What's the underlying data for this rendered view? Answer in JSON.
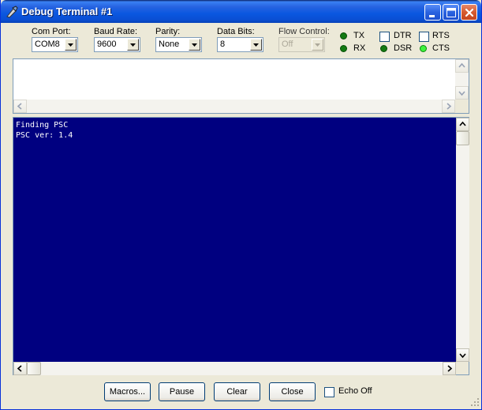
{
  "window": {
    "title": "Debug Terminal #1"
  },
  "settings": {
    "com_port": {
      "label": "Com Port:",
      "value": "COM8"
    },
    "baud_rate": {
      "label": "Baud Rate:",
      "value": "9600"
    },
    "parity": {
      "label": "Parity:",
      "value": "None"
    },
    "data_bits": {
      "label": "Data Bits:",
      "value": "8"
    },
    "flow_control": {
      "label": "Flow Control:",
      "value": "Off"
    }
  },
  "signals": {
    "tx": {
      "label": "TX",
      "state": "off"
    },
    "rx": {
      "label": "RX",
      "state": "off"
    },
    "dsr": {
      "label": "DSR",
      "state": "off"
    },
    "cts": {
      "label": "CTS",
      "state": "on"
    },
    "dtr": {
      "label": "DTR",
      "checked": false
    },
    "rts": {
      "label": "RTS",
      "checked": false
    }
  },
  "output": {
    "lines": [
      "Finding PSC",
      "PSC ver: 1.4"
    ]
  },
  "buttons": {
    "macros": "Macros...",
    "pause": "Pause",
    "clear": "Clear",
    "close": "Close"
  },
  "echo_off": {
    "label": "Echo Off",
    "checked": false
  },
  "colors": {
    "terminal_bg": "#000080",
    "terminal_fg": "#ffffff",
    "led_on": "#3df23d",
    "led_off": "#137a13"
  }
}
